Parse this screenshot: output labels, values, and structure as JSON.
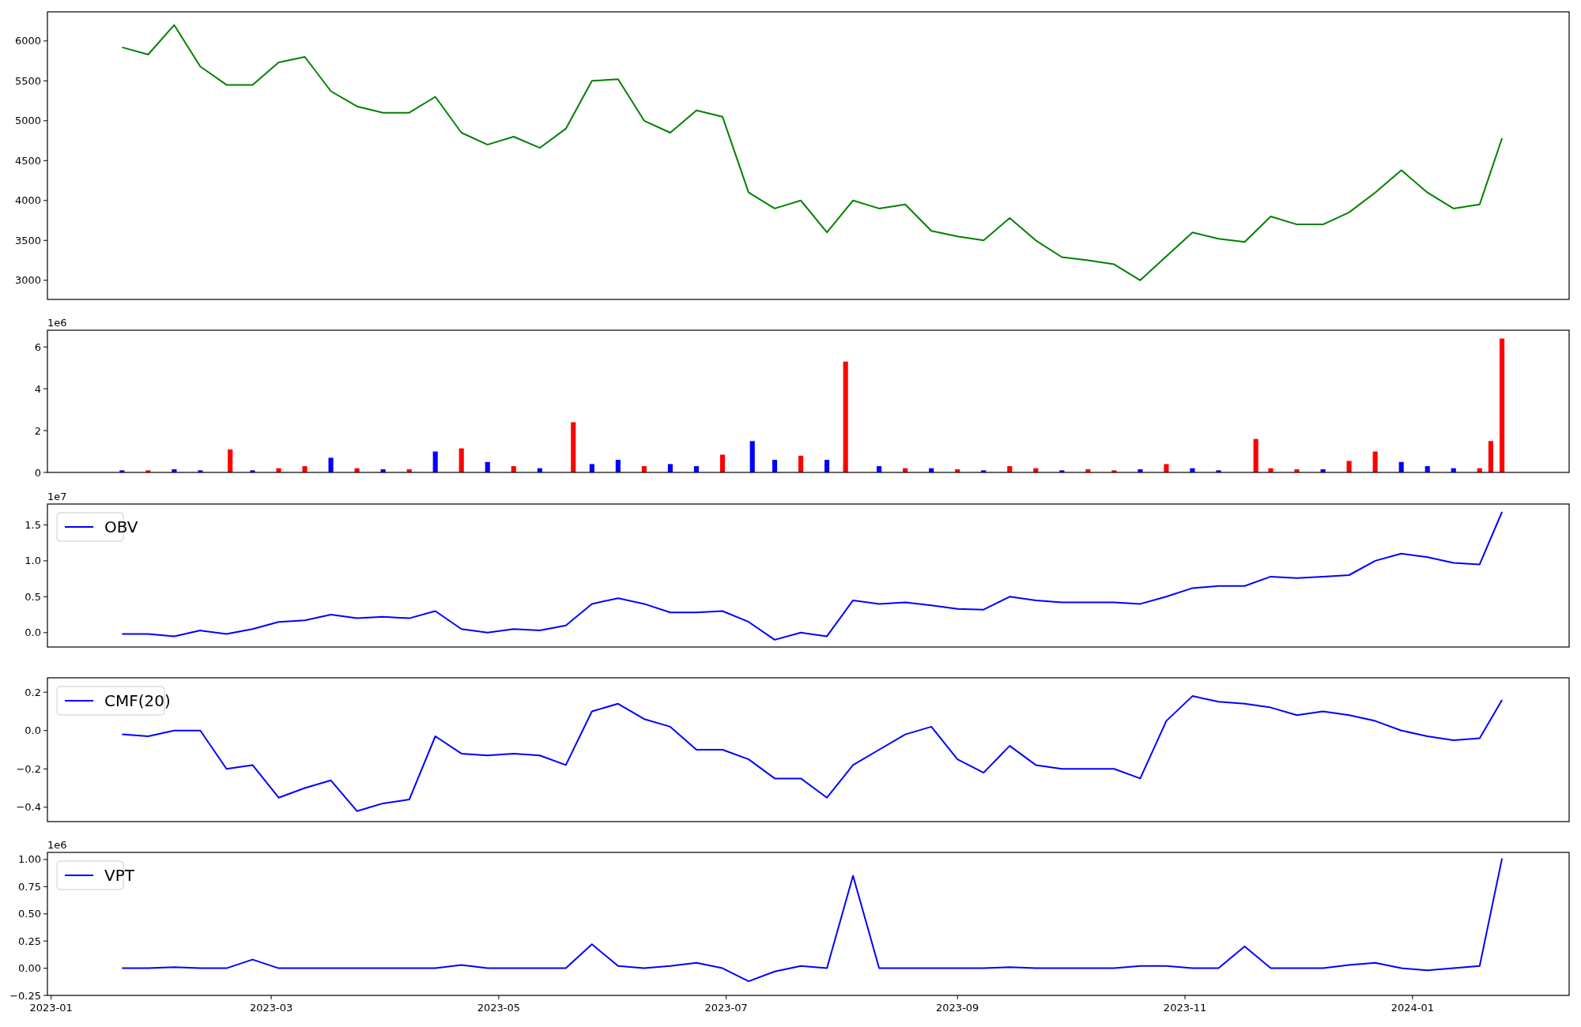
{
  "panels": [
    {
      "chart_data": {
        "type": "line",
        "xlim": [
          "2022-12-31",
          "2024-02-12"
        ],
        "ylim": [
          2760,
          6365
        ],
        "yticks": [
          3000,
          3500,
          4000,
          4500,
          5000,
          5500,
          6000
        ],
        "x": [
          "2023-01-20",
          "2023-01-27",
          "2023-02-03",
          "2023-02-10",
          "2023-02-17",
          "2023-02-24",
          "2023-03-03",
          "2023-03-10",
          "2023-03-17",
          "2023-03-24",
          "2023-03-31",
          "2023-04-07",
          "2023-04-14",
          "2023-04-21",
          "2023-04-28",
          "2023-05-05",
          "2023-05-12",
          "2023-05-19",
          "2023-05-26",
          "2023-06-02",
          "2023-06-09",
          "2023-06-16",
          "2023-06-23",
          "2023-06-30",
          "2023-07-07",
          "2023-07-14",
          "2023-07-21",
          "2023-07-28",
          "2023-08-04",
          "2023-08-11",
          "2023-08-18",
          "2023-08-25",
          "2023-09-01",
          "2023-09-08",
          "2023-09-15",
          "2023-09-22",
          "2023-09-29",
          "2023-10-06",
          "2023-10-13",
          "2023-10-20",
          "2023-10-27",
          "2023-11-03",
          "2023-11-10",
          "2023-11-17",
          "2023-11-24",
          "2023-12-01",
          "2023-12-08",
          "2023-12-15",
          "2023-12-22",
          "2023-12-29",
          "2024-01-05",
          "2024-01-12",
          "2024-01-19",
          "2024-01-25"
        ],
        "series": [
          {
            "color": "#008000",
            "values": [
              5920,
              5830,
              6200,
              5680,
              5450,
              5450,
              5730,
              5800,
              5370,
              5180,
              5100,
              5100,
              5300,
              4850,
              4700,
              4800,
              4660,
              4900,
              5500,
              5520,
              5000,
              4850,
              5130,
              5050,
              4100,
              3900,
              4000,
              3600,
              4000,
              3900,
              3950,
              3620,
              3550,
              3500,
              3780,
              3500,
              3290,
              3250,
              3200,
              3000,
              3300,
              3600,
              3520,
              3480,
              3800,
              3700,
              3700,
              3850,
              4100,
              4380,
              4100,
              3900,
              3950,
              4780
            ]
          }
        ]
      }
    },
    {
      "offset_label": "1e6",
      "chart_data": {
        "type": "bar",
        "xlim": [
          "2022-12-31",
          "2024-02-12"
        ],
        "ylim": [
          0,
          6.8
        ],
        "yticks": [
          0,
          2,
          4,
          6
        ],
        "x": [
          "2023-01-20",
          "2023-01-27",
          "2023-02-03",
          "2023-02-10",
          "2023-02-18",
          "2023-02-24",
          "2023-03-03",
          "2023-03-10",
          "2023-03-17",
          "2023-03-24",
          "2023-03-31",
          "2023-04-07",
          "2023-04-14",
          "2023-04-21",
          "2023-04-28",
          "2023-05-05",
          "2023-05-12",
          "2023-05-21",
          "2023-05-26",
          "2023-06-02",
          "2023-06-09",
          "2023-06-16",
          "2023-06-23",
          "2023-06-30",
          "2023-07-08",
          "2023-07-14",
          "2023-07-21",
          "2023-07-28",
          "2023-08-02",
          "2023-08-11",
          "2023-08-18",
          "2023-08-25",
          "2023-09-01",
          "2023-09-08",
          "2023-09-15",
          "2023-09-22",
          "2023-09-29",
          "2023-10-06",
          "2023-10-13",
          "2023-10-20",
          "2023-10-27",
          "2023-11-03",
          "2023-11-10",
          "2023-11-20",
          "2023-11-24",
          "2023-12-01",
          "2023-12-08",
          "2023-12-15",
          "2023-12-22",
          "2023-12-29",
          "2024-01-05",
          "2024-01-12",
          "2024-01-19",
          "2024-01-22",
          "2024-01-25"
        ],
        "series": [
          {
            "color": "#ff0000",
            "values": [
              null,
              0.1,
              null,
              null,
              1.1,
              null,
              0.2,
              0.3,
              null,
              0.2,
              null,
              0.15,
              null,
              1.15,
              null,
              0.3,
              null,
              2.4,
              null,
              null,
              0.3,
              null,
              null,
              0.85,
              null,
              null,
              0.8,
              null,
              5.3,
              null,
              0.2,
              null,
              0.15,
              null,
              0.3,
              0.2,
              null,
              0.15,
              0.1,
              null,
              0.4,
              null,
              null,
              1.6,
              0.2,
              0.15,
              null,
              0.55,
              1.0,
              null,
              null,
              null,
              0.2,
              1.5,
              6.4
            ]
          },
          {
            "color": "#0000ff",
            "values": [
              0.1,
              null,
              0.15,
              0.1,
              null,
              0.1,
              null,
              null,
              0.7,
              null,
              0.15,
              null,
              1.0,
              null,
              0.5,
              null,
              0.2,
              null,
              0.4,
              0.6,
              null,
              0.4,
              0.3,
              null,
              1.5,
              0.6,
              null,
              0.6,
              null,
              0.3,
              null,
              0.2,
              null,
              0.1,
              null,
              null,
              0.1,
              null,
              null,
              0.15,
              null,
              0.2,
              0.1,
              null,
              null,
              null,
              0.15,
              null,
              null,
              0.5,
              0.3,
              0.2,
              null,
              null,
              null
            ]
          }
        ]
      }
    },
    {
      "offset_label": "1e7",
      "chart_data": {
        "type": "line",
        "xlim": [
          "2022-12-31",
          "2024-02-12"
        ],
        "ylim": [
          -0.2,
          1.79
        ],
        "yticks": [
          {
            "value": 0,
            "label": "0.0"
          },
          {
            "value": 0.5,
            "label": "0.5"
          },
          {
            "value": 1,
            "label": "1.0"
          },
          {
            "value": 1.5,
            "label": "1.5"
          }
        ],
        "x": [
          "2023-01-20",
          "2023-01-27",
          "2023-02-03",
          "2023-02-10",
          "2023-02-17",
          "2023-02-24",
          "2023-03-03",
          "2023-03-10",
          "2023-03-17",
          "2023-03-24",
          "2023-03-31",
          "2023-04-07",
          "2023-04-14",
          "2023-04-21",
          "2023-04-28",
          "2023-05-05",
          "2023-05-12",
          "2023-05-19",
          "2023-05-26",
          "2023-06-02",
          "2023-06-09",
          "2023-06-16",
          "2023-06-23",
          "2023-06-30",
          "2023-07-07",
          "2023-07-14",
          "2023-07-21",
          "2023-07-28",
          "2023-08-04",
          "2023-08-11",
          "2023-08-18",
          "2023-08-25",
          "2023-09-01",
          "2023-09-08",
          "2023-09-15",
          "2023-09-22",
          "2023-09-29",
          "2023-10-06",
          "2023-10-13",
          "2023-10-20",
          "2023-10-27",
          "2023-11-03",
          "2023-11-10",
          "2023-11-17",
          "2023-11-24",
          "2023-12-01",
          "2023-12-08",
          "2023-12-15",
          "2023-12-22",
          "2023-12-29",
          "2024-01-05",
          "2024-01-12",
          "2024-01-19",
          "2024-01-25"
        ],
        "series": [
          {
            "name": "OBV",
            "color": "#0000ff",
            "values": [
              -0.02,
              -0.02,
              -0.05,
              0.03,
              -0.02,
              0.05,
              0.15,
              0.17,
              0.25,
              0.2,
              0.22,
              0.2,
              0.3,
              0.05,
              0.0,
              0.05,
              0.03,
              0.1,
              0.4,
              0.48,
              0.4,
              0.28,
              0.28,
              0.3,
              0.15,
              -0.1,
              0.0,
              -0.05,
              0.45,
              0.4,
              0.42,
              0.38,
              0.33,
              0.32,
              0.5,
              0.45,
              0.42,
              0.42,
              0.42,
              0.4,
              0.5,
              0.62,
              0.65,
              0.65,
              0.78,
              0.76,
              0.78,
              0.8,
              1.0,
              1.1,
              1.05,
              0.97,
              0.95,
              1.68
            ]
          }
        ]
      }
    },
    {
      "chart_data": {
        "type": "line",
        "xlim": [
          "2022-12-31",
          "2024-02-12"
        ],
        "ylim": [
          -0.475,
          0.275
        ],
        "yticks": [
          {
            "value": -0.4,
            "label": "−0.4"
          },
          {
            "value": -0.2,
            "label": "−0.2"
          },
          {
            "value": 0,
            "label": "0.0"
          },
          {
            "value": 0.2,
            "label": "0.2"
          }
        ],
        "x": [
          "2023-01-20",
          "2023-01-27",
          "2023-02-03",
          "2023-02-10",
          "2023-02-17",
          "2023-02-24",
          "2023-03-03",
          "2023-03-10",
          "2023-03-17",
          "2023-03-24",
          "2023-03-31",
          "2023-04-07",
          "2023-04-14",
          "2023-04-21",
          "2023-04-28",
          "2023-05-05",
          "2023-05-12",
          "2023-05-19",
          "2023-05-26",
          "2023-06-02",
          "2023-06-09",
          "2023-06-16",
          "2023-06-23",
          "2023-06-30",
          "2023-07-07",
          "2023-07-14",
          "2023-07-21",
          "2023-07-28",
          "2023-08-04",
          "2023-08-11",
          "2023-08-18",
          "2023-08-25",
          "2023-09-01",
          "2023-09-08",
          "2023-09-15",
          "2023-09-22",
          "2023-09-29",
          "2023-10-06",
          "2023-10-13",
          "2023-10-20",
          "2023-10-27",
          "2023-11-03",
          "2023-11-10",
          "2023-11-17",
          "2023-11-24",
          "2023-12-01",
          "2023-12-08",
          "2023-12-15",
          "2023-12-22",
          "2023-12-29",
          "2024-01-05",
          "2024-01-12",
          "2024-01-19",
          "2024-01-25"
        ],
        "series": [
          {
            "name": "CMF(20)",
            "color": "#0000ff",
            "values": [
              -0.02,
              -0.03,
              0.0,
              0.0,
              -0.2,
              -0.18,
              -0.35,
              -0.3,
              -0.26,
              -0.42,
              -0.38,
              -0.36,
              -0.03,
              -0.12,
              -0.13,
              -0.12,
              -0.13,
              -0.18,
              0.1,
              0.14,
              0.06,
              0.02,
              -0.1,
              -0.1,
              -0.15,
              -0.25,
              -0.25,
              -0.35,
              -0.18,
              -0.1,
              -0.02,
              0.02,
              -0.15,
              -0.22,
              -0.08,
              -0.18,
              -0.2,
              -0.2,
              -0.2,
              -0.25,
              0.05,
              0.18,
              0.15,
              0.14,
              0.12,
              0.08,
              0.1,
              0.08,
              0.05,
              0.0,
              -0.03,
              -0.05,
              -0.04,
              0.16
            ]
          }
        ]
      }
    },
    {
      "offset_label": "1e6",
      "chart_data": {
        "type": "line",
        "xlim": [
          "2022-12-31",
          "2024-02-12"
        ],
        "ylim": [
          -0.25,
          1.065
        ],
        "yticks": [
          {
            "value": -0.25,
            "label": "−0.25"
          },
          {
            "value": 0,
            "label": "0.00"
          },
          {
            "value": 0.25,
            "label": "0.25"
          },
          {
            "value": 0.5,
            "label": "0.50"
          },
          {
            "value": 0.75,
            "label": "0.75"
          },
          {
            "value": 1,
            "label": "1.00"
          }
        ],
        "xticks": [
          {
            "value": "2023-01-01",
            "label": "2023-01"
          },
          {
            "value": "2023-03-01",
            "label": "2023-03"
          },
          {
            "value": "2023-05-01",
            "label": "2023-05"
          },
          {
            "value": "2023-07-01",
            "label": "2023-07"
          },
          {
            "value": "2023-09-01",
            "label": "2023-09"
          },
          {
            "value": "2023-11-01",
            "label": "2023-11"
          },
          {
            "value": "2024-01-01",
            "label": "2024-01"
          }
        ],
        "x": [
          "2023-01-20",
          "2023-01-27",
          "2023-02-03",
          "2023-02-10",
          "2023-02-17",
          "2023-02-24",
          "2023-03-03",
          "2023-03-10",
          "2023-03-17",
          "2023-03-24",
          "2023-03-31",
          "2023-04-07",
          "2023-04-14",
          "2023-04-21",
          "2023-04-28",
          "2023-05-05",
          "2023-05-12",
          "2023-05-19",
          "2023-05-26",
          "2023-06-02",
          "2023-06-09",
          "2023-06-16",
          "2023-06-23",
          "2023-06-30",
          "2023-07-07",
          "2023-07-14",
          "2023-07-21",
          "2023-07-28",
          "2023-08-04",
          "2023-08-11",
          "2023-08-18",
          "2023-08-25",
          "2023-09-01",
          "2023-09-08",
          "2023-09-15",
          "2023-09-22",
          "2023-09-29",
          "2023-10-06",
          "2023-10-13",
          "2023-10-20",
          "2023-10-27",
          "2023-11-03",
          "2023-11-10",
          "2023-11-17",
          "2023-11-24",
          "2023-12-01",
          "2023-12-08",
          "2023-12-15",
          "2023-12-22",
          "2023-12-29",
          "2024-01-05",
          "2024-01-12",
          "2024-01-19",
          "2024-01-25"
        ],
        "series": [
          {
            "name": "VPT",
            "color": "#0000ff",
            "values": [
              0,
              0,
              0.01,
              0,
              0,
              0.08,
              0,
              0,
              0,
              0,
              0,
              0,
              0,
              0.03,
              0,
              0,
              0,
              0,
              0.22,
              0.02,
              0,
              0.02,
              0.05,
              0,
              -0.12,
              -0.03,
              0.02,
              0,
              0.85,
              0,
              0,
              0,
              0,
              0,
              0.01,
              0,
              0,
              0,
              0,
              0.02,
              0.02,
              0,
              0,
              0.2,
              0,
              0,
              0,
              0.03,
              0.05,
              0,
              -0.02,
              0,
              0.02,
              1.01
            ]
          }
        ]
      }
    }
  ]
}
